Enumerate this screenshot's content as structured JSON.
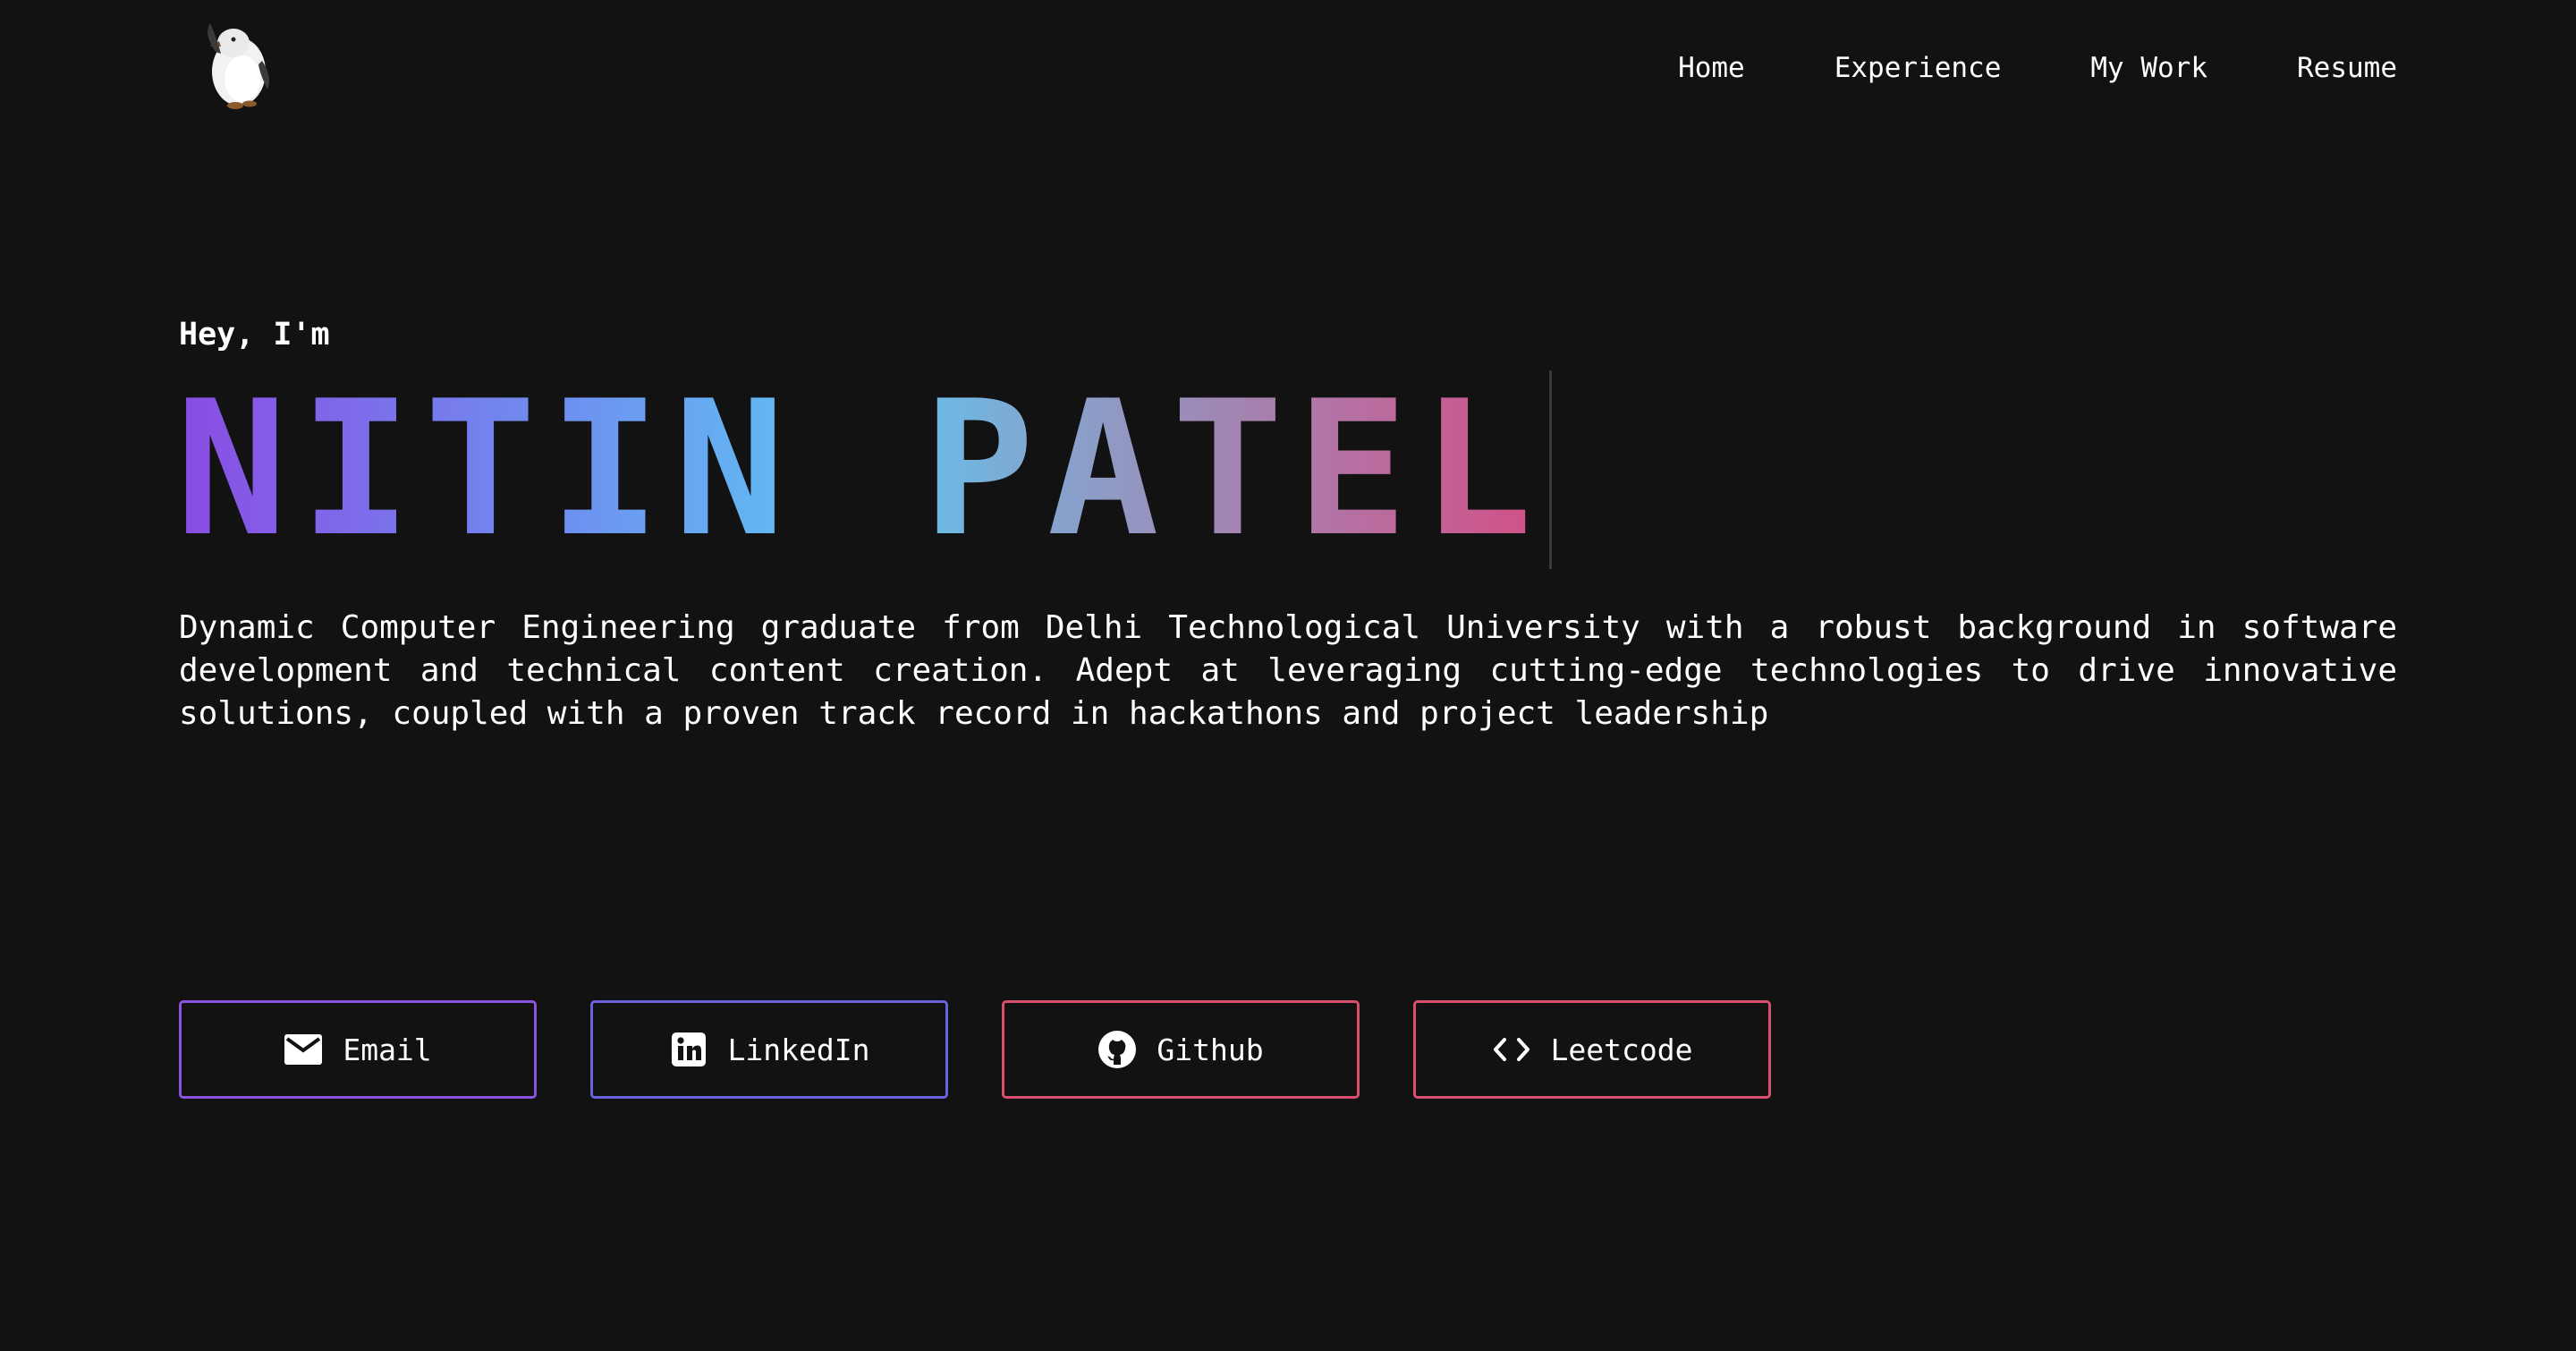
{
  "nav": {
    "logo_icon": "penguin-icon",
    "links": [
      {
        "label": "Home"
      },
      {
        "label": "Experience"
      },
      {
        "label": "My Work"
      },
      {
        "label": "Resume"
      }
    ]
  },
  "hero": {
    "greeting": "Hey, I'm",
    "name": "NITIN PATEL",
    "bio": "Dynamic Computer Engineering graduate from Delhi Technological University with a robust background in software development and technical content creation. Adept at leveraging cutting-edge technologies to drive innovative solutions, coupled with a proven track record in hackathons and project leadership"
  },
  "buttons": [
    {
      "label": "Email",
      "icon": "mail-icon",
      "border_color": "#8a52e0"
    },
    {
      "label": "LinkedIn",
      "icon": "linkedin-icon",
      "border_color": "#6a62dc"
    },
    {
      "label": "Github",
      "icon": "github-icon",
      "border_color": "#d9506f"
    },
    {
      "label": "Leetcode",
      "icon": "code-brackets-icon",
      "border_color": "#d9506f"
    }
  ],
  "colors": {
    "background": "#121212",
    "text": "#ffffff",
    "gradient": [
      "#8a4ce3",
      "#6e8ff0",
      "#5ec7f2",
      "#8f9ac4",
      "#d34f86"
    ]
  }
}
